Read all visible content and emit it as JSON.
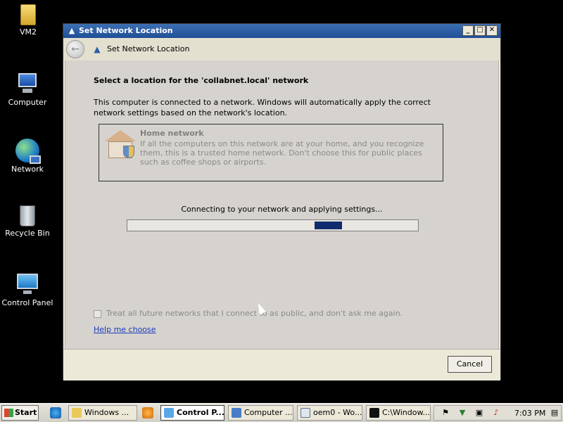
{
  "desktop": {
    "icons": [
      {
        "label": "VM2"
      },
      {
        "label": "Computer"
      },
      {
        "label": "Network"
      },
      {
        "label": "Recycle Bin"
      },
      {
        "label": "Control Panel"
      }
    ]
  },
  "window": {
    "title": "Set Network Location",
    "nav_title": "Set Network Location",
    "heading": "Select a location for the 'collabnet.local' network",
    "description": "This computer is connected to a network. Windows will automatically apply the correct network settings based on the network's location.",
    "option": {
      "title": "Home network",
      "description": "If all the computers on this network are at your home, and you recognize them, this is a trusted home network.  Don't choose this for public places such as coffee shops or airports."
    },
    "progress": {
      "label": "Connecting to your network and applying settings...",
      "indicator": "marquee",
      "segment_start_fraction": 0.645,
      "segment_width_fraction": 0.095
    },
    "checkbox": {
      "label": "Treat all future networks that I connect to as public, and don't ask me again.",
      "checked": false,
      "enabled": false
    },
    "help_link": "Help me choose",
    "cancel_label": "Cancel"
  },
  "taskbar": {
    "start_label": "Start",
    "tasks": [
      {
        "label": "Windows ...",
        "icon": "explorer-icon",
        "active": false
      },
      {
        "label": "Control P...",
        "icon": "control-panel-icon",
        "active": true
      },
      {
        "label": "Computer ...",
        "icon": "computer-icon",
        "active": false
      },
      {
        "label": "oem0 - Wo...",
        "icon": "notepad-icon",
        "active": false
      },
      {
        "label": "C:\\Window...",
        "icon": "cmd-icon",
        "active": false
      }
    ],
    "clock": "7:03 PM"
  }
}
